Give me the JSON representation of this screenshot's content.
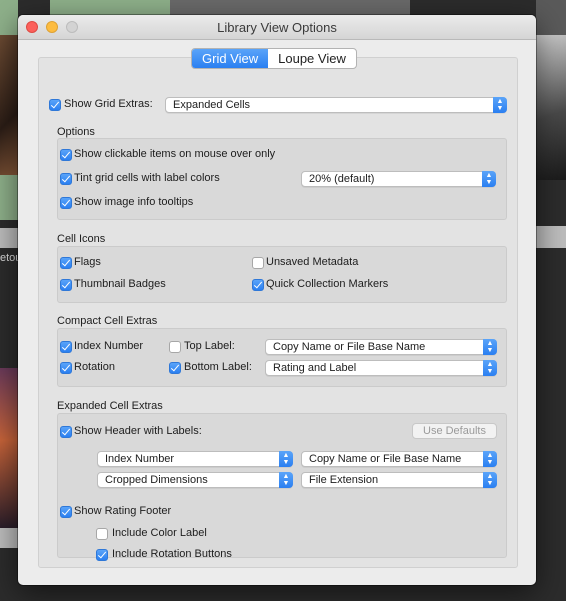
{
  "window": {
    "title": "Library View Options"
  },
  "background": {
    "left_label": "etou"
  },
  "tabs": [
    {
      "label": "Grid View",
      "active": true
    },
    {
      "label": "Loupe View",
      "active": false
    }
  ],
  "grid_extras": {
    "label": "Show Grid Extras:",
    "checked": true,
    "selected": "Expanded Cells"
  },
  "options": {
    "title": "Options",
    "items": [
      {
        "label": "Show clickable items on mouse over only",
        "checked": true
      },
      {
        "label": "Tint grid cells with label colors",
        "checked": true
      },
      {
        "label": "Show image info tooltips",
        "checked": true
      }
    ],
    "tint_select": "20% (default)"
  },
  "cell_icons": {
    "title": "Cell Icons",
    "items": [
      {
        "label": "Flags",
        "checked": true
      },
      {
        "label": "Unsaved Metadata",
        "checked": false
      },
      {
        "label": "Thumbnail Badges",
        "checked": true
      },
      {
        "label": "Quick Collection Markers",
        "checked": true
      }
    ]
  },
  "compact": {
    "title": "Compact Cell Extras",
    "index_number": {
      "label": "Index Number",
      "checked": true
    },
    "rotation": {
      "label": "Rotation",
      "checked": true
    },
    "top_label": {
      "label": "Top Label:",
      "checked": false,
      "selected": "Copy Name or File Base Name"
    },
    "bottom_label": {
      "label": "Bottom Label:",
      "checked": true,
      "selected": "Rating and Label"
    }
  },
  "expanded": {
    "title": "Expanded Cell Extras",
    "header": {
      "label": "Show Header with Labels:",
      "checked": true
    },
    "use_defaults": "Use Defaults",
    "selects": [
      "Index Number",
      "Copy Name or File Base Name",
      "Cropped Dimensions",
      "File Extension"
    ],
    "footer": {
      "label": "Show Rating Footer",
      "checked": true
    },
    "color_label": {
      "label": "Include Color Label",
      "checked": false
    },
    "rotation_buttons": {
      "label": "Include Rotation Buttons",
      "checked": true
    }
  }
}
